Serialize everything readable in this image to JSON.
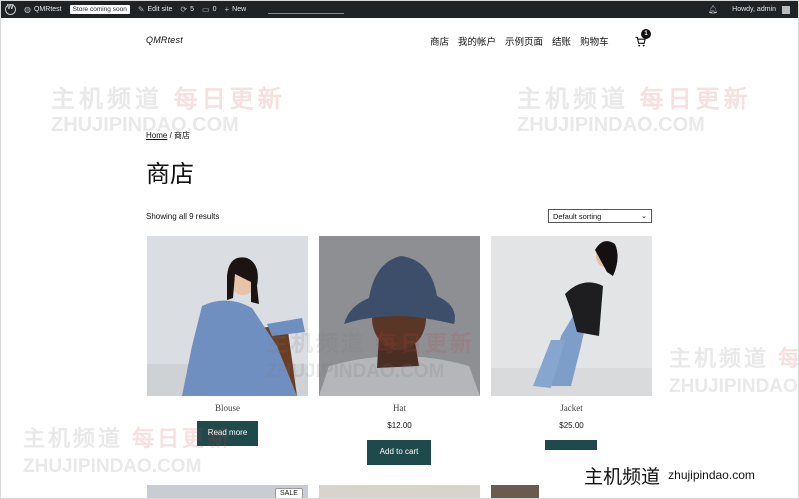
{
  "adminbar": {
    "site_name": "QMRtest",
    "store_badge": "Store coming soon",
    "edit_site": "Edit site",
    "updates_count": "5",
    "comments_count": "0",
    "new_label": "New",
    "howdy": "Howdy, admin"
  },
  "header": {
    "site_title": "QMRtest",
    "nav": [
      "商店",
      "我的帐户",
      "示例页面",
      "结账",
      "购物车"
    ],
    "cart_count": "1"
  },
  "breadcrumb": {
    "home": "Home",
    "sep": " / ",
    "current": "商店"
  },
  "page_title": "商店",
  "results_text": "Showing all 9 results",
  "sorting": {
    "selected": "Default sorting"
  },
  "products": [
    {
      "name": "Blouse",
      "price": "",
      "button": "Read more"
    },
    {
      "name": "Hat",
      "price": "$12.00",
      "button": "Add to cart"
    },
    {
      "name": "Jacket",
      "price": "$25.00",
      "button": ""
    }
  ],
  "sale_badge": "SALE",
  "watermark": {
    "cn_gray": "主机频道",
    "cn_red": "每日更新",
    "en": "ZHUJIPINDAO.COM",
    "banner_cn": "主机频道",
    "banner_en": "zhujipindao.com"
  }
}
